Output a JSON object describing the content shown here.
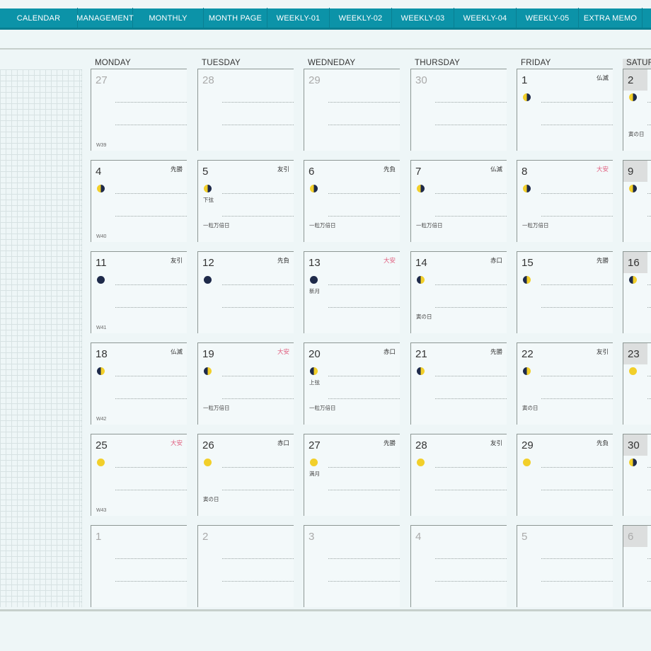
{
  "nav": [
    "CALENDAR",
    "MANAGEMENT",
    "MONTHLY",
    "MONTH PAGE",
    "WEEKLY-01",
    "WEEKLY-02",
    "WEEKLY-03",
    "WEEKLY-04",
    "WEEKLY-05",
    "EXTRA MEMO"
  ],
  "days": [
    "MONDAY",
    "TUESDAY",
    "WEDNEDAY",
    "THURSDAY",
    "FRIDAY",
    "SATURDAY"
  ],
  "weeks": [
    {
      "week": "W39",
      "cells": [
        {
          "d": "27",
          "other": true
        },
        {
          "d": "28",
          "other": true
        },
        {
          "d": "29",
          "other": true
        },
        {
          "d": "30",
          "other": true
        },
        {
          "d": "1",
          "r": "仏滅",
          "moon": "left-lit"
        },
        {
          "d": "2",
          "moon": "left-lit",
          "n2": "寅の日"
        }
      ]
    },
    {
      "week": "W40",
      "cells": [
        {
          "d": "4",
          "r": "先勝",
          "moon": "left-lit"
        },
        {
          "d": "5",
          "r": "友引",
          "moon": "left-lit",
          "n1": "下弦",
          "n2": "一粒万倍日"
        },
        {
          "d": "6",
          "r": "先負",
          "moon": "left-lit",
          "n2": "一粒万倍日"
        },
        {
          "d": "7",
          "r": "仏滅",
          "moon": "left-lit",
          "n2": "一粒万倍日"
        },
        {
          "d": "8",
          "r": "大安",
          "t": true,
          "moon": "left-lit",
          "n2": "一粒万倍日"
        },
        {
          "d": "9",
          "moon": "left-lit"
        }
      ]
    },
    {
      "week": "W41",
      "cells": [
        {
          "d": "11",
          "r": "友引",
          "moon": "new"
        },
        {
          "d": "12",
          "r": "先負",
          "moon": "new"
        },
        {
          "d": "13",
          "r": "大安",
          "t": true,
          "moon": "new",
          "n1": "新月"
        },
        {
          "d": "14",
          "r": "赤口",
          "moon": "right-lit",
          "n2": "寅の日"
        },
        {
          "d": "15",
          "r": "先勝",
          "moon": "right-lit"
        },
        {
          "d": "16",
          "moon": "right-lit"
        }
      ]
    },
    {
      "week": "W42",
      "cells": [
        {
          "d": "18",
          "r": "仏滅",
          "moon": "right-lit"
        },
        {
          "d": "19",
          "r": "大安",
          "t": true,
          "moon": "right-lit",
          "n2": "一粒万倍日"
        },
        {
          "d": "20",
          "r": "赤口",
          "moon": "right-lit",
          "n1": "上弦",
          "n2": "一粒万倍日"
        },
        {
          "d": "21",
          "r": "先勝",
          "moon": "right-lit"
        },
        {
          "d": "22",
          "r": "友引",
          "moon": "right-lit",
          "n2": "寅の日"
        },
        {
          "d": "23",
          "moon": "full"
        }
      ]
    },
    {
      "week": "W43",
      "cells": [
        {
          "d": "25",
          "r": "大安",
          "t": true,
          "moon": "full"
        },
        {
          "d": "26",
          "r": "赤口",
          "moon": "full",
          "n2": "寅の日"
        },
        {
          "d": "27",
          "r": "先勝",
          "moon": "full",
          "n1": "満月"
        },
        {
          "d": "28",
          "r": "友引",
          "moon": "full"
        },
        {
          "d": "29",
          "r": "先負",
          "moon": "full"
        },
        {
          "d": "30",
          "moon": "left-lit"
        }
      ]
    },
    {
      "week": "",
      "cells": [
        {
          "d": "1",
          "other": true
        },
        {
          "d": "2",
          "other": true
        },
        {
          "d": "3",
          "other": true
        },
        {
          "d": "4",
          "other": true
        },
        {
          "d": "5",
          "other": true
        },
        {
          "d": "6",
          "other": true
        }
      ]
    }
  ]
}
